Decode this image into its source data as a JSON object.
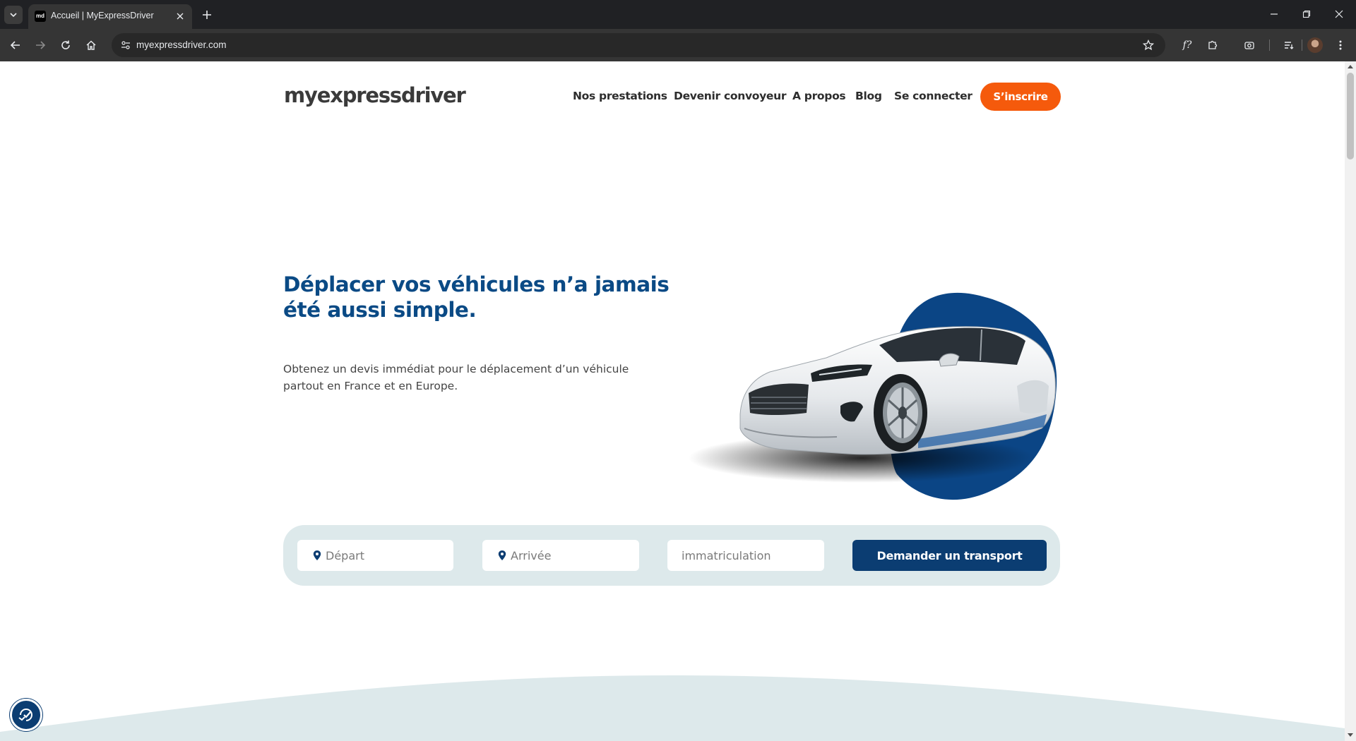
{
  "browser": {
    "tab": {
      "title": "Accueil | MyExpressDriver",
      "favicon_text": "md"
    },
    "url": "myexpressdriver.com",
    "toolbar_icons": [
      "back-icon",
      "forward-icon",
      "reload-icon",
      "home-icon",
      "site-info-icon",
      "bookmark-star-icon",
      "font-icon",
      "extensions-icon",
      "screenshot-icon",
      "reading-list-icon",
      "profile-avatar",
      "menu-icon"
    ],
    "window_controls": [
      "minimize-icon",
      "restore-icon",
      "close-icon"
    ]
  },
  "header": {
    "logo": "myexpressdriver",
    "nav": [
      {
        "label": "Nos prestations"
      },
      {
        "label": "Devenir convoyeur"
      },
      {
        "label": "A propos"
      },
      {
        "label": "Blog"
      },
      {
        "label": "Se connecter"
      }
    ],
    "signup_label": "S’inscrire"
  },
  "hero": {
    "title": "Déplacer vos véhicules n’a jamais été aussi simple.",
    "subtitle": "Obtenez un devis immédiat pour le déplacement d’un véhicule partout en France et en Europe."
  },
  "search": {
    "departure_placeholder": "Départ",
    "arrival_placeholder": "Arrivée",
    "plate_placeholder": "immatriculation",
    "submit_label": "Demander un transport"
  },
  "colors": {
    "brand_blue": "#0a4a85",
    "cta_blue": "#0b3d72",
    "accent_orange": "#f55a0c",
    "panel_bg": "#dde9eb"
  }
}
